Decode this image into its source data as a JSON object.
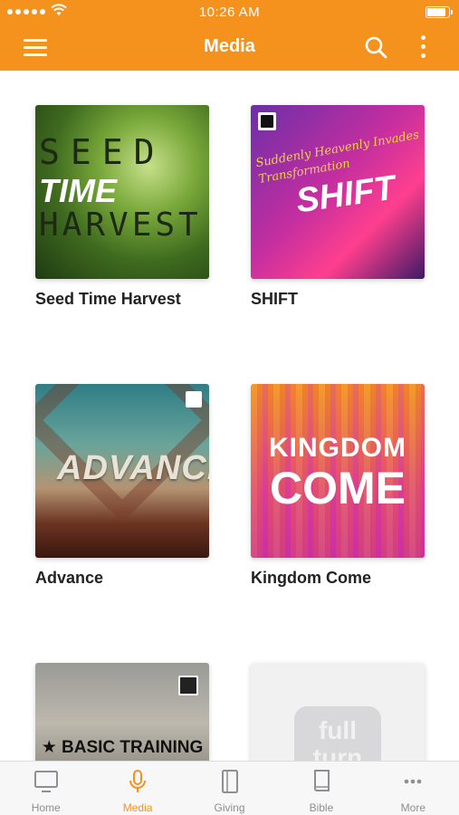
{
  "status_bar": {
    "time": "10:26 AM"
  },
  "header": {
    "title": "Media",
    "accent_color": "#f5921e",
    "icons": [
      "hamburger-menu-icon",
      "search-icon",
      "more-vertical-icon"
    ]
  },
  "media_items": [
    {
      "title": "Seed Time Harvest",
      "art": {
        "line1": "SEED",
        "line2": "TIME",
        "line3": "HARVEST"
      }
    },
    {
      "title": "SHIFT",
      "art": {
        "word": "SHIFT",
        "scribble": "Suddenly Heavenly Invades Transformation"
      }
    },
    {
      "title": "Advance",
      "art": {
        "word": "ADVANCE"
      }
    },
    {
      "title": "Kingdom Come",
      "art": {
        "line1": "KINGDOM",
        "line2": "COME"
      }
    },
    {
      "title": "",
      "art": {
        "word": "★ BASIC TRAINING ★"
      }
    },
    {
      "title": "",
      "art": {
        "word": "full turn"
      }
    }
  ],
  "tab_bar": {
    "active_color": "#f5921e",
    "tabs": [
      {
        "label": "Home",
        "icon": "monitor-icon"
      },
      {
        "label": "Media",
        "icon": "microphone-icon"
      },
      {
        "label": "Giving",
        "icon": "tablet-icon"
      },
      {
        "label": "Bible",
        "icon": "book-icon"
      },
      {
        "label": "More",
        "icon": "ellipsis-icon"
      }
    ]
  }
}
